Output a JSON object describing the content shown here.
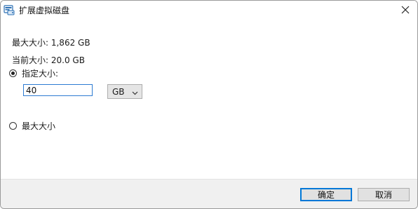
{
  "window": {
    "title": "扩展虚拟磁盘",
    "icon": "virtual-disk-icon",
    "close_icon": "close-icon"
  },
  "info": {
    "max_size": "最大大小: 1,862 GB",
    "current_size": "当前大小: 20.0 GB"
  },
  "options": {
    "specify_label": "指定大小:",
    "specify_selected": true,
    "maximum_label": "最大大小",
    "maximum_selected": false
  },
  "size_field": {
    "value": "40"
  },
  "unit_select": {
    "selected": "GB"
  },
  "buttons": {
    "ok": "确定",
    "cancel": "取消"
  },
  "colors": {
    "accent": "#0078d7",
    "footer_bg": "#f0f0f0"
  }
}
